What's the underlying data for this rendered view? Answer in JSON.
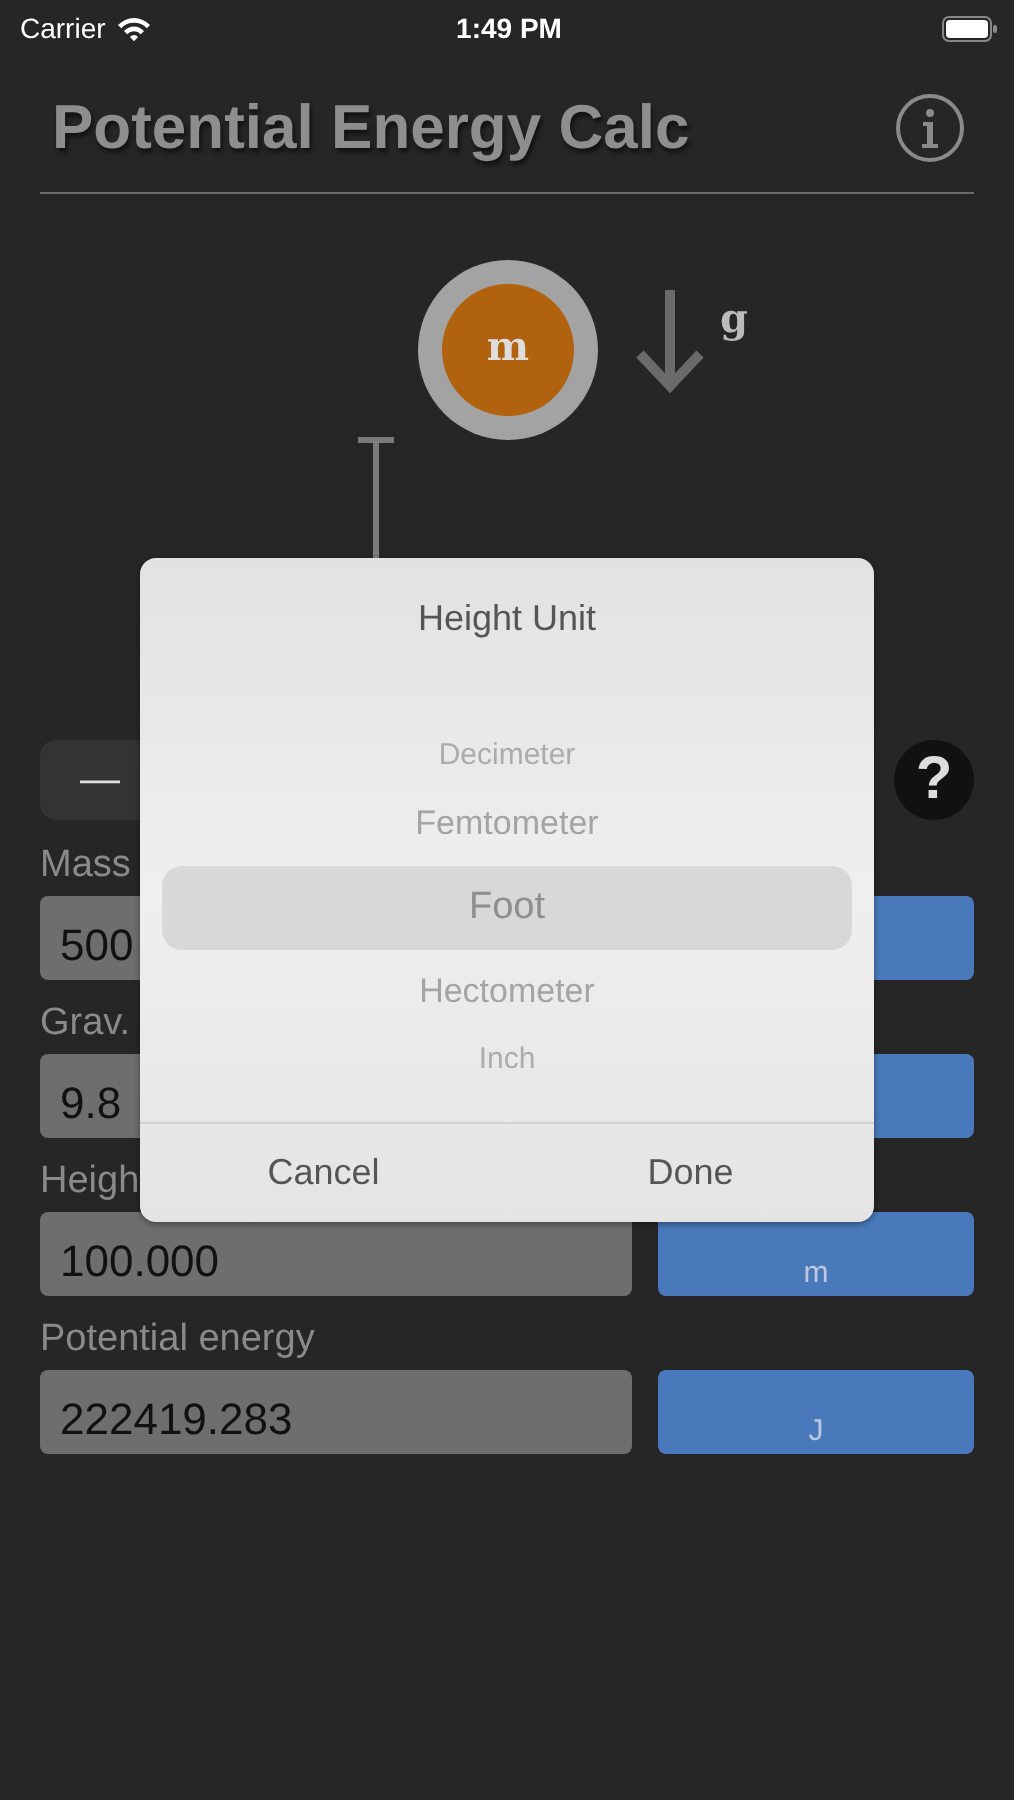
{
  "status_bar": {
    "carrier": "Carrier",
    "time": "1:49 PM"
  },
  "title": "Potential Energy Calc",
  "diagram": {
    "mass_label": "m",
    "gravity_label": "g"
  },
  "stepper": {
    "minus": "—"
  },
  "help": "?",
  "fields": [
    {
      "label": "Mass",
      "value": "500"
    },
    {
      "label": "Grav.",
      "value": "9.8"
    },
    {
      "label": "Heigh",
      "value": "100.000",
      "unit": "m"
    },
    {
      "label": "Potential energy",
      "value": "222419.283",
      "unit": "J"
    }
  ],
  "dialog": {
    "title": "Height Unit",
    "options": [
      {
        "label": "Decimeter",
        "selected": false
      },
      {
        "label": "Femtometer",
        "selected": false
      },
      {
        "label": "Foot",
        "selected": true
      },
      {
        "label": "Hectometer",
        "selected": false
      },
      {
        "label": "Inch",
        "selected": false
      }
    ],
    "buttons": [
      "Cancel",
      "Done"
    ]
  }
}
